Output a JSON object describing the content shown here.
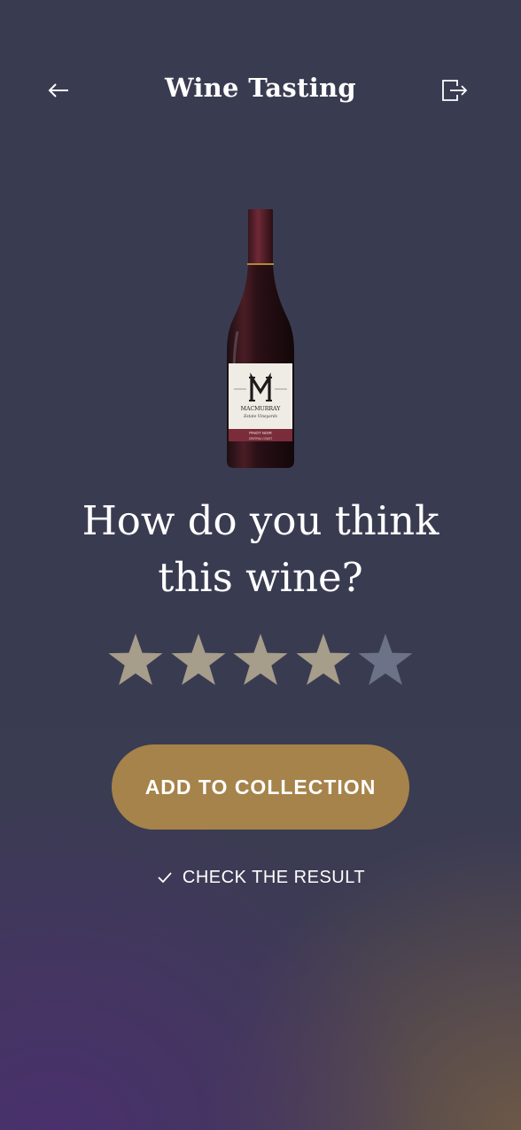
{
  "colors": {
    "background": "#393c51",
    "accent": "#a6834a",
    "star_filled": "#a69d8b",
    "star_empty": "#6c7287",
    "text": "#ffffff"
  },
  "header": {
    "back_icon": "arrow-left-icon",
    "title": "Wine Tasting",
    "logout_icon": "logout-icon"
  },
  "wine": {
    "image_icon": "wine-bottle-image",
    "label_brand": "MACMURRAY",
    "label_subtitle": "Estate Vineyards",
    "label_varietal": "PINOT NOIR",
    "label_region": "CENTRAL COAST"
  },
  "question": {
    "line1": "How do you think",
    "line2": "this wine?"
  },
  "rating": {
    "value": 4,
    "max": 5,
    "icon": "star-icon"
  },
  "actions": {
    "add_label": "ADD TO COLLECTION",
    "check_label": "CHECK THE RESULT",
    "check_icon": "checkmark-icon"
  }
}
